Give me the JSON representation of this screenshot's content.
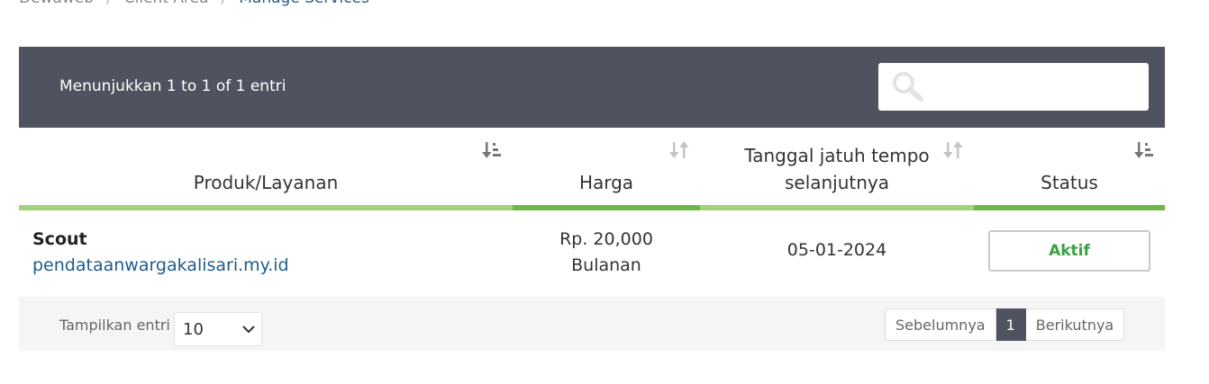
{
  "breadcrumb": [
    "Dewaweb",
    "Client Area",
    "Manage Services"
  ],
  "table_info": "Menunjukkan 1 to 1 of 1 entri",
  "search": {
    "placeholder": "",
    "icon": "search-icon"
  },
  "columns": [
    {
      "label": "Produk/Layanan",
      "sort": "sort-desc-icon"
    },
    {
      "label": "Harga",
      "sort": "sort-both-icon"
    },
    {
      "label": "Tanggal jatuh tempo\nselanjutnya",
      "sort": "sort-both-icon"
    },
    {
      "label": "Status",
      "sort": "sort-desc-icon"
    }
  ],
  "rows": [
    {
      "product": "Scout",
      "domain": "pendataanwargakalisari.my.id",
      "price": "Rp. 20,000",
      "cycle": "Bulanan",
      "due_date": "05-01-2024",
      "status": "Aktif"
    }
  ],
  "footer": {
    "show_label": "Tampilkan entri",
    "page_size": "10",
    "prev": "Sebelumnya",
    "current_page": "1",
    "next": "Berikutnya"
  },
  "colors": {
    "toolbar": "#4f535f",
    "accent_green": "#6fb84a",
    "light_green": "#a3d17c",
    "status_green": "#3aa142",
    "link_blue": "#1f5b8c"
  }
}
